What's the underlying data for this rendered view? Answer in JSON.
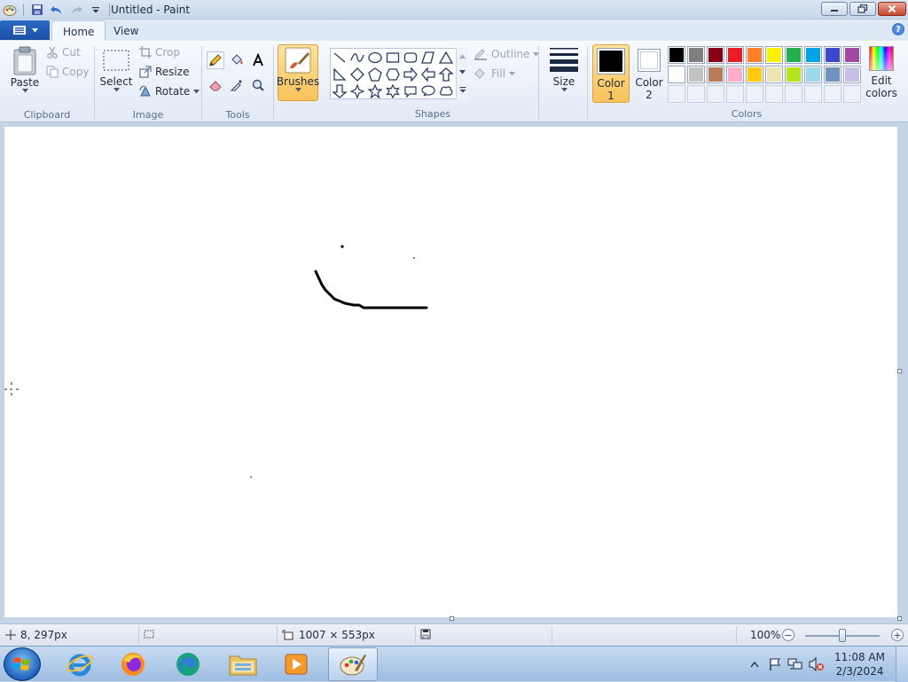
{
  "window": {
    "title": "Untitled - Paint"
  },
  "tabs": [
    {
      "label": "Home",
      "active": true
    },
    {
      "label": "View",
      "active": false
    }
  ],
  "ribbon": {
    "clipboard": {
      "paste": "Paste",
      "cut": "Cut",
      "copy": "Copy",
      "label": "Clipboard"
    },
    "image": {
      "select": "Select",
      "crop": "Crop",
      "resize": "Resize",
      "rotate": "Rotate",
      "label": "Image"
    },
    "tools": {
      "label": "Tools"
    },
    "brushes": {
      "label": "Brushes"
    },
    "shapes": {
      "outline": "Outline",
      "fill": "Fill",
      "label": "Shapes"
    },
    "size": {
      "label": "Size"
    },
    "color1": {
      "label_line1": "Color",
      "label_line2": "1",
      "value": "#000000"
    },
    "color2": {
      "label_line1": "Color",
      "label_line2": "2",
      "value": "#ffffff"
    },
    "colors": {
      "label": "Colors",
      "edit_line1": "Edit",
      "edit_line2": "colors",
      "palette_row1": [
        "#000000",
        "#7f7f7f",
        "#880015",
        "#ed1c24",
        "#ff7f27",
        "#fff200",
        "#22b14c",
        "#00a2e8",
        "#3f48cc",
        "#a349a4"
      ],
      "palette_row2": [
        "#ffffff",
        "#c3c3c3",
        "#b97a57",
        "#ffaec9",
        "#ffc90e",
        "#efe4b0",
        "#b5e61d",
        "#99d9ea",
        "#7092be",
        "#c8bfe7"
      ]
    }
  },
  "status": {
    "cursor_position": "8, 297px",
    "canvas_size": "1007 × 553px",
    "zoom": "100%",
    "zoom_level": 1.0
  },
  "taskbar": {
    "apps": [
      "internet-explorer",
      "firefox",
      "edge",
      "file-explorer",
      "media-player",
      "paint"
    ],
    "time": "11:08 AM",
    "date": "2/3/2024"
  }
}
